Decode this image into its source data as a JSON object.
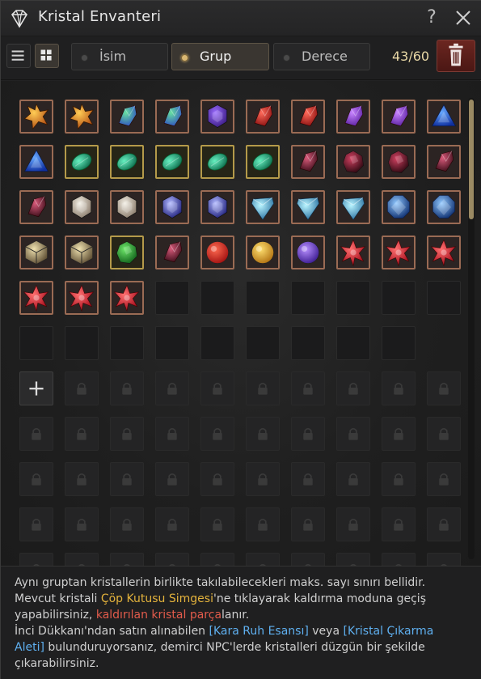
{
  "window": {
    "title": "Kristal Envanteri",
    "help_label": "?"
  },
  "toolbar": {
    "sort_options": [
      {
        "label": "İsim",
        "selected": false
      },
      {
        "label": "Grup",
        "selected": true
      },
      {
        "label": "Derece",
        "selected": false
      }
    ],
    "count": "43/60"
  },
  "crystals": [
    "amber-spiked",
    "amber-spiked",
    "emerald-blue-shard",
    "emerald-blue-shard",
    "violet-hexagon",
    "red-shard",
    "red-shard",
    "purple-shard",
    "purple-shard",
    "blue-triangle",
    "blue-triangle",
    "teal-oval",
    "teal-oval",
    "teal-oval",
    "teal-oval",
    "teal-oval",
    "dark-ruby-shard",
    "dark-ruby-round",
    "dark-ruby-round",
    "dark-ruby-shard",
    "dark-ruby-shard",
    "white-hexagon",
    "white-hexagon",
    "indigo-hexagon",
    "indigo-hexagon",
    "ice-diamond",
    "ice-diamond",
    "ice-diamond",
    "blue-octagon",
    "blue-octagon",
    "silver-gold-cube",
    "silver-gold-cube",
    "green-gem",
    "dark-ruby-shard",
    "red-orb",
    "gold-orb",
    "violet-orb",
    "red-star",
    "red-star",
    "red-star",
    "red-star",
    "red-star",
    "red-star"
  ],
  "grid": {
    "filled": 43,
    "empty_unlocked": 16,
    "add_slot": 1,
    "locked_rows_visible": 5
  },
  "info": {
    "line1": "Aynı gruptan kristallerin birlikte takılabilecekleri maks. sayı sınırı bellidir.",
    "line2_a": "Mevcut kristali ",
    "line2_link": "Çöp Kutusu Simgesi",
    "line2_b": "'ne tıklayarak kaldırma moduna geçiş",
    "line3_a": "yapabilirsiniz, ",
    "line3_red": "kaldırılan kristal parça",
    "line3_b": "lanır.",
    "line4_a": "İnci Dükkanı'ndan satın alınabilen ",
    "line4_link1": "[Kara Ruh Esansı]",
    "line4_b": " veya ",
    "line4_link2": "[Kristal Çıkarma",
    "line5_link2": "Aleti]",
    "line5_b": " bulunduruyorsanız, demirci NPC'lerde kristalleri düzgün bir şekilde",
    "line6": "çıkarabilirsiniz."
  },
  "colors": {
    "accent_gold": "#e3b23c",
    "accent_red": "#e25b4b",
    "accent_blue": "#5fb0f0",
    "trash_red": "#5b1d18"
  }
}
